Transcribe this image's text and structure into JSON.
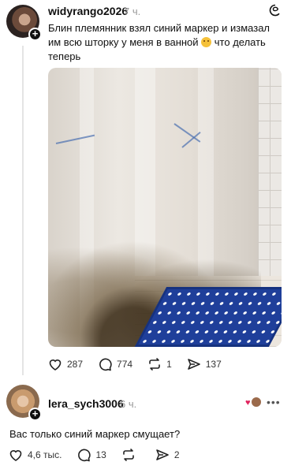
{
  "post": {
    "username": "widyrango2026",
    "time": "7 ч.",
    "text_before_emoji": "Блин племянник взял синий маркер и измазал им всю шторку у меня в ванной ",
    "text_after_emoji": " что делать теперь",
    "emoji_icon": "unamused-face-emoji",
    "photo_icon": "shower-curtain-photo",
    "likes": "287",
    "comments": "774",
    "reposts": "1",
    "shares": "137"
  },
  "reply": {
    "username": "lera_sych3006",
    "time": "6 ч.",
    "text": "Вас только синий маркер смущает?",
    "likes": "4,6 тыс.",
    "comments": "13",
    "reposts": "",
    "shares": "2",
    "more_label": "•••"
  },
  "colors": {
    "accent_text": "#101010",
    "muted_text": "#999999",
    "heart_red": "#e0245e",
    "rug_blue": "#1f3f9a"
  }
}
